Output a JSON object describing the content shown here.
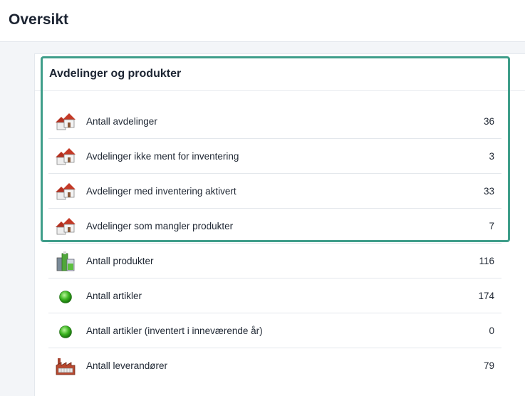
{
  "header": {
    "title": "Oversikt"
  },
  "card": {
    "title": "Avdelinger og produkter"
  },
  "rows": [
    {
      "label": "Antall avdelinger",
      "value": "36",
      "icon": "houses-icon"
    },
    {
      "label": "Avdelinger ikke ment for inventering",
      "value": "3",
      "icon": "houses-icon"
    },
    {
      "label": "Avdelinger med inventering aktivert",
      "value": "33",
      "icon": "houses-icon"
    },
    {
      "label": "Avdelinger som mangler produkter",
      "value": "7",
      "icon": "houses-icon"
    },
    {
      "label": "Antall produkter",
      "value": "116",
      "icon": "products-icon"
    },
    {
      "label": "Antall artikler",
      "value": "174",
      "icon": "green-dot-icon"
    },
    {
      "label": "Antall artikler (inventert i inneværende år)",
      "value": "0",
      "icon": "green-dot-icon"
    },
    {
      "label": "Antall leverandører",
      "value": "79",
      "icon": "factory-icon"
    }
  ],
  "colors": {
    "highlight": "#3f9e8a",
    "accent_green": "#3cb521",
    "house_red": "#b5301f"
  }
}
